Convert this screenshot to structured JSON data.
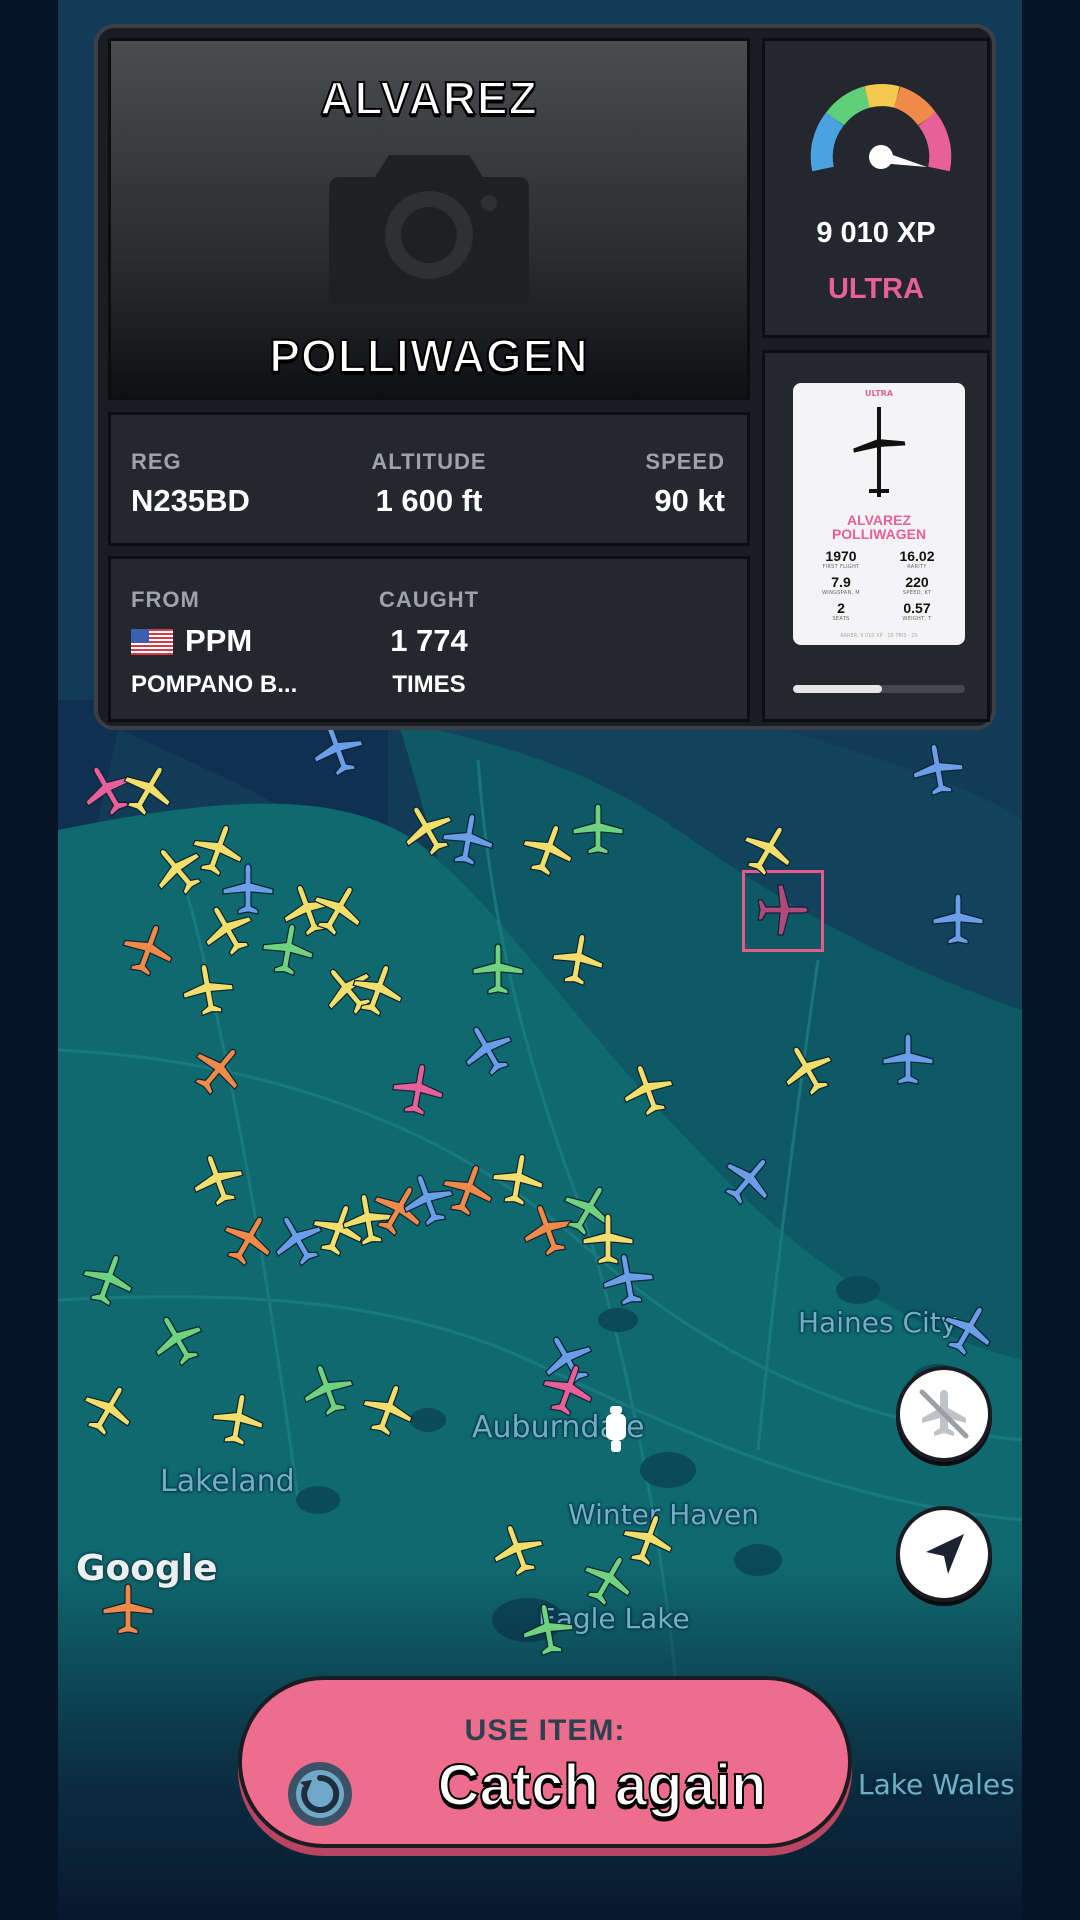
{
  "aircraft": {
    "title_top": "ALVAREZ",
    "title_bottom": "POLLIWAGEN"
  },
  "stats": {
    "reg_label": "REG",
    "reg_value": "N235BD",
    "altitude_label": "ALTITUDE",
    "altitude_value": "1 600 ft",
    "speed_label": "SPEED",
    "speed_value": "90 kt"
  },
  "origin": {
    "from_label": "FROM",
    "airport_code": "PPM",
    "airport_name": "POMPANO B...",
    "caught_label": "CAUGHT",
    "caught_count": "1 774",
    "caught_suffix": "TIMES",
    "flag_icon": "us-flag-icon"
  },
  "xp": {
    "value": "9 010 XP",
    "rarity": "ULTRA",
    "rarity_color": "#e8609a"
  },
  "mini_card": {
    "tag": "ULTRA",
    "name_line1": "ALVAREZ",
    "name_line2": "POLLIWAGEN",
    "stats": [
      {
        "value": "1970",
        "label": "FIRST FLIGHT"
      },
      {
        "value": "16.02",
        "label": "RARITY"
      },
      {
        "value": "7.9",
        "label": "WINGSPAN, M"
      },
      {
        "value": "220",
        "label": "SPEED, KT"
      },
      {
        "value": "2",
        "label": "SEATS"
      },
      {
        "value": "0.57",
        "label": "WEIGHT, T"
      }
    ],
    "footer": "RARER: 9 010 XP · 16 TRIS · 20",
    "progress_fraction": 0.52
  },
  "map": {
    "places": [
      "Lakeland",
      "Auburndale",
      "Winter Haven",
      "Eagle Lake",
      "Haines City",
      "Lake Wales"
    ],
    "attribution": "Google"
  },
  "controls": {
    "hide_planes_icon": "airplane-off-icon",
    "locate_icon": "navigation-arrow-icon"
  },
  "action": {
    "label": "USE ITEM:",
    "text": "Catch again",
    "icon": "refresh-item-icon",
    "color": "#ef6d8c"
  }
}
